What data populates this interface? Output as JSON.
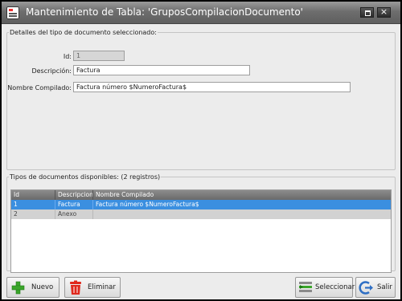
{
  "window": {
    "title": "Mantenimiento de Tabla: 'GruposCompilacionDocumento'"
  },
  "details": {
    "legend": "Detalles del tipo de documento seleccionado:",
    "id_label": "Id:",
    "id_value": "1",
    "descripcion_label": "Descripción:",
    "descripcion_value": "Factura",
    "nombre_label": "Nombre Compilado:",
    "nombre_value": "Factura número $NumeroFactura$"
  },
  "list": {
    "legend": "Tipos de documentos disponibles:  (2 registros)",
    "columns": [
      "Id",
      "Descripcion",
      "Nombre Compilado"
    ],
    "rows": [
      [
        "1",
        "Factura",
        "Factura número $NumeroFactura$"
      ],
      [
        "2",
        "Anexo",
        ""
      ]
    ],
    "selected_row": 0
  },
  "buttons": {
    "nuevo": "Nuevo",
    "eliminar": "Eliminar",
    "seleccionar": "Seleccionar",
    "salir": "Salir"
  },
  "icons": {
    "app": "table-document-icon",
    "nuevo": "plus-icon",
    "eliminar": "trash-icon",
    "seleccionar": "select-list-icon",
    "salir": "exit-icon",
    "restore": "restore-icon",
    "close": "close-icon"
  },
  "colors": {
    "selection": "#3b8fe0",
    "plus": "#3aa52a",
    "trash": "#e0291d",
    "exit": "#2f6fc4"
  }
}
